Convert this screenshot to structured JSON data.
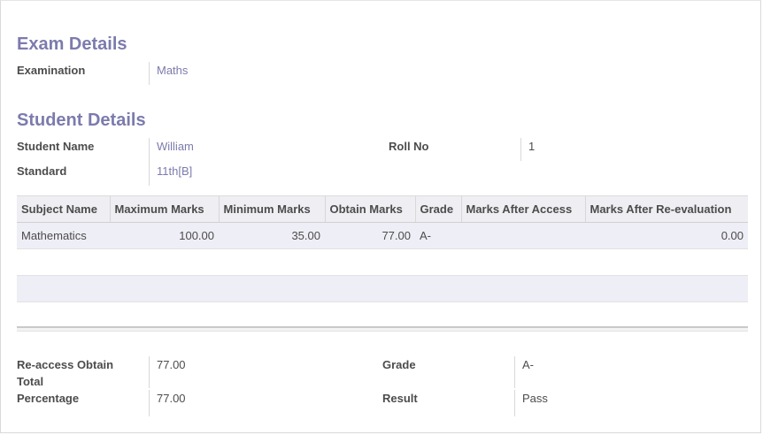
{
  "exam": {
    "title": "Exam Details",
    "examination_label": "Examination",
    "examination_value": "Maths"
  },
  "student": {
    "title": "Student Details",
    "name_label": "Student Name",
    "name_value": "William",
    "roll_label": "Roll No",
    "roll_value": "1",
    "standard_label": "Standard",
    "standard_value": "11th[B]"
  },
  "table": {
    "headers": [
      "Subject Name",
      "Maximum Marks",
      "Minimum Marks",
      "Obtain Marks",
      "Grade",
      "Marks After Access",
      "Marks After Re-evaluation"
    ],
    "rows": [
      [
        "Mathematics",
        "100.00",
        "35.00",
        "77.00",
        "A-",
        "",
        "0.00"
      ]
    ]
  },
  "summary": {
    "reaccess_label_line1": "Re-access Obtain",
    "reaccess_label_line2": "Total",
    "reaccess_value": "77.00",
    "percentage_label": "Percentage",
    "percentage_value": "77.00",
    "grade_label": "Grade",
    "grade_value": "A-",
    "result_label": "Result",
    "result_value": "Pass"
  }
}
